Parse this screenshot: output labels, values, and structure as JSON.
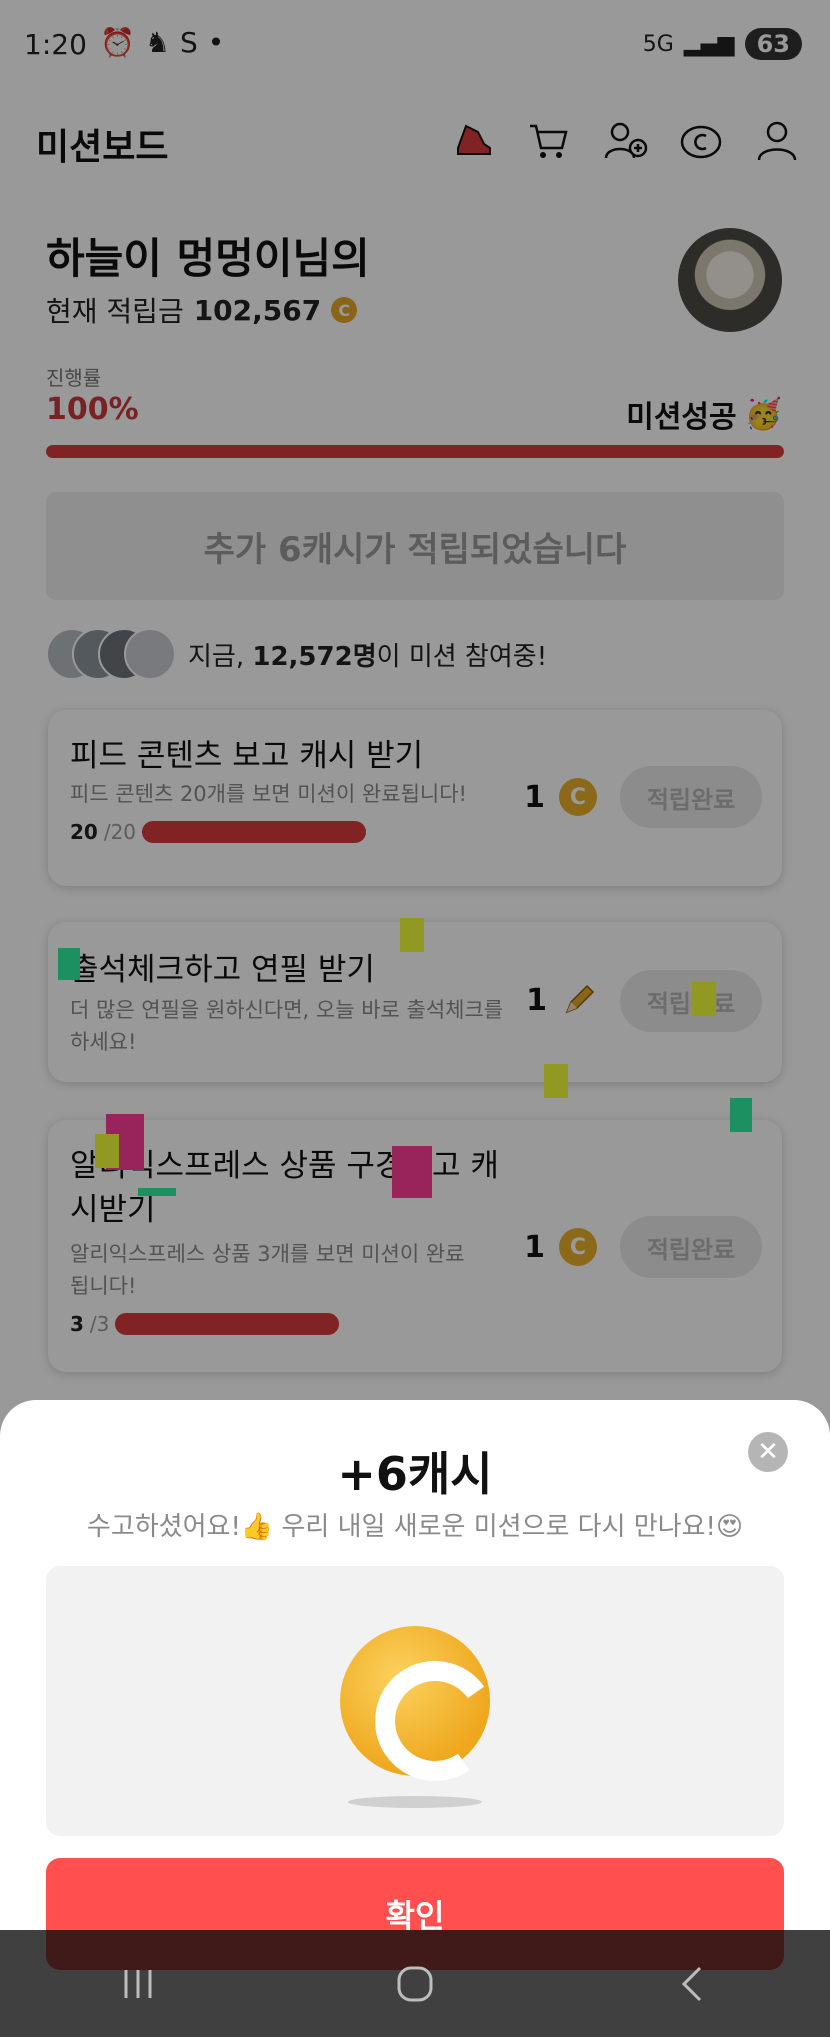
{
  "status_bar": {
    "time": "1:20",
    "icons": [
      "alarm-icon",
      "notification-icon",
      "app-s-icon",
      "dot-icon"
    ],
    "network": "5G",
    "battery": "63"
  },
  "header": {
    "title": "미션보드",
    "icons": [
      "shoe-icon",
      "cart-icon",
      "add-friend-icon",
      "cash-icon",
      "profile-icon"
    ]
  },
  "profile": {
    "name": "하늘이  멍멍이님의",
    "balance_label": "현재 적립금",
    "balance": "102,567",
    "coin_symbol": "C"
  },
  "progress": {
    "label": "진행률",
    "value": "100%",
    "percent": 100,
    "status": "미션성공",
    "status_emoji": "🥳"
  },
  "bonus_message": "추가 6캐시가 적립되었습니다",
  "participants": {
    "prefix": "지금, ",
    "count": "12,572명",
    "suffix": "이 미션 참여중!"
  },
  "missions": [
    {
      "title": "피드 콘텐츠 보고 캐시 받기",
      "desc": "피드 콘텐츠 20개를 보면 미션이 완료됩니다!",
      "done": "20",
      "total": "/20",
      "reward": "1",
      "reward_icon": "coin-icon",
      "button": "적립완료"
    },
    {
      "title": "출석체크하고 연필 받기",
      "desc": "더 많은 연필을 원하신다면, 오늘 바로 출석체크를 하세요!",
      "reward": "1",
      "reward_icon": "pencil-icon",
      "button": "적립완료"
    },
    {
      "title": "알리익스프레스 상품 구경하고 캐시받기",
      "desc": "알리익스프레스 상품 3개를 보면 미션이 완료됩니다!",
      "done": "3",
      "total": "/3",
      "reward": "1",
      "reward_icon": "coin-icon",
      "button": "적립완료"
    }
  ],
  "sheet": {
    "title": "+6캐시",
    "subtitle": "수고하셨어요!👍 우리 내일 새로운 미션으로 다시 만나요!😍",
    "confirm": "확인",
    "close_icon": "close-icon"
  },
  "colors": {
    "accent": "#d8393f",
    "confirm": "#ff4f4f",
    "coin": "#e9ad2b"
  }
}
